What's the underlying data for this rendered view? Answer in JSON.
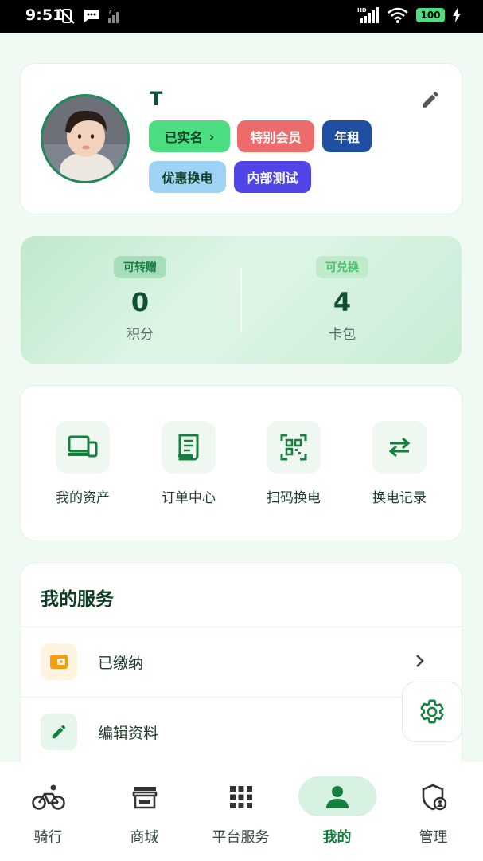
{
  "status_bar": {
    "time": "9:51",
    "battery": "100",
    "hd_label": "HD"
  },
  "profile": {
    "username": "T",
    "tags": [
      {
        "label": "已实名",
        "chevron": "›",
        "bg": "#4ade80",
        "fg": "#0f3d26"
      },
      {
        "label": "特别会员",
        "bg": "#ee6b6b",
        "fg": "#ffffff"
      },
      {
        "label": "年租",
        "bg": "#1e4fa3",
        "fg": "#ffffff"
      },
      {
        "label": "优惠换电",
        "bg": "#9fd3f5",
        "fg": "#0f3d26"
      },
      {
        "label": "内部测试",
        "bg": "#4f46e5",
        "fg": "#ffffff"
      }
    ]
  },
  "points": {
    "left": {
      "chip": "可转赠",
      "value": "0",
      "label": "积分"
    },
    "right": {
      "chip": "可兑换",
      "value": "4",
      "label": "卡包"
    }
  },
  "quick_actions": [
    {
      "label": "我的资产",
      "icon": "devices-icon"
    },
    {
      "label": "订单中心",
      "icon": "receipt-icon"
    },
    {
      "label": "扫码换电",
      "icon": "qr-scan-icon"
    },
    {
      "label": "换电记录",
      "icon": "swap-arrows-icon"
    }
  ],
  "services": {
    "title": "我的服务",
    "items": [
      {
        "label": "已缴纳",
        "icon": "wallet-icon"
      },
      {
        "label": "编辑资料",
        "icon": "pencil-icon"
      }
    ]
  },
  "tabbar": [
    {
      "label": "骑行",
      "icon": "bicycle-icon",
      "active": false
    },
    {
      "label": "商城",
      "icon": "store-icon",
      "active": false
    },
    {
      "label": "平台服务",
      "icon": "grid-icon",
      "active": false
    },
    {
      "label": "我的",
      "icon": "person-icon",
      "active": true
    },
    {
      "label": "管理",
      "icon": "shield-user-icon",
      "active": false
    }
  ],
  "colors": {
    "primary": "#15803d",
    "page_bg": "#eefaf2",
    "active_pill": "#d6f1df",
    "title_text": "#0f5132"
  }
}
